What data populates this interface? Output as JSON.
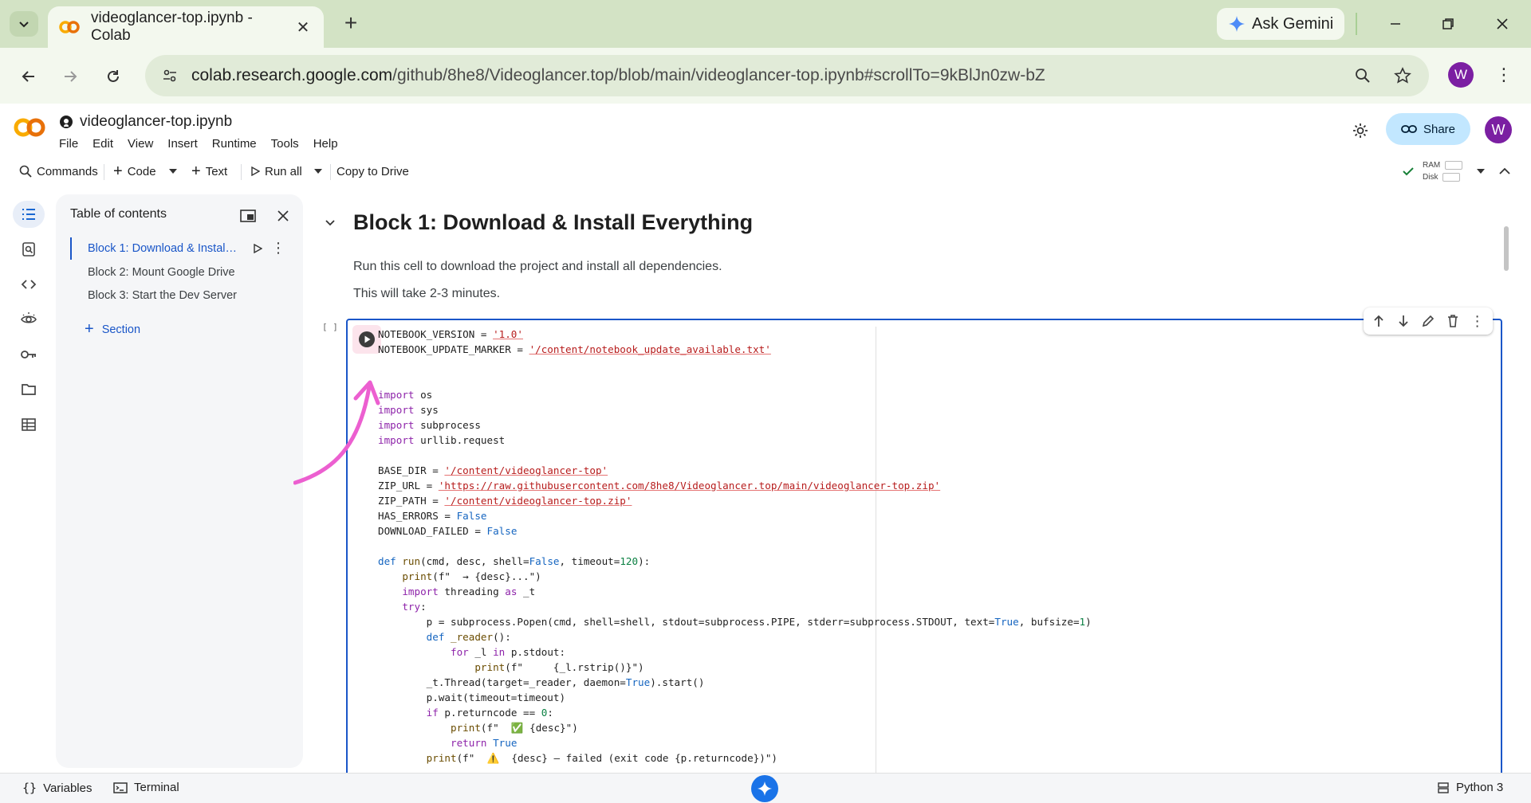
{
  "browser": {
    "tab_title": "videoglancer-top.ipynb - Colab",
    "gemini_label": "Ask Gemini",
    "url_host": "colab.research.google.com",
    "url_rest": "/github/8he8/Videoglancer.top/blob/main/videoglancer-top.ipynb#scrollTo=9kBlJn0zw-bZ",
    "profile_initial": "W"
  },
  "header": {
    "notebook_name": "videoglancer-top.ipynb",
    "menu": [
      "File",
      "Edit",
      "View",
      "Insert",
      "Runtime",
      "Tools",
      "Help"
    ],
    "share_label": "Share",
    "user_initial": "W"
  },
  "toolbar": {
    "commands": "Commands",
    "code": "Code",
    "text": "Text",
    "run_all": "Run all",
    "copy_to_drive": "Copy to Drive",
    "ram_label": "RAM",
    "disk_label": "Disk"
  },
  "toc": {
    "title": "Table of contents",
    "items": [
      {
        "label": "Block 1: Download & Install Everything"
      },
      {
        "label": "Block 2: Mount Google Drive"
      },
      {
        "label": "Block 3: Start the Dev Server"
      }
    ],
    "add_section": "Section"
  },
  "main": {
    "heading": "Block 1: Download & Install Everything",
    "desc1": "Run this cell to download the project and install all dependencies.",
    "desc2": "This will take 2-3 minutes.",
    "exec_count": "[ ]"
  },
  "statusbar": {
    "variables": "Variables",
    "terminal": "Terminal",
    "runtime": "Python 3"
  },
  "colors": {
    "accent": "#1a56c8",
    "chrome_green": "#d3e3c5",
    "annotation_pink": "#ec5fd0"
  }
}
